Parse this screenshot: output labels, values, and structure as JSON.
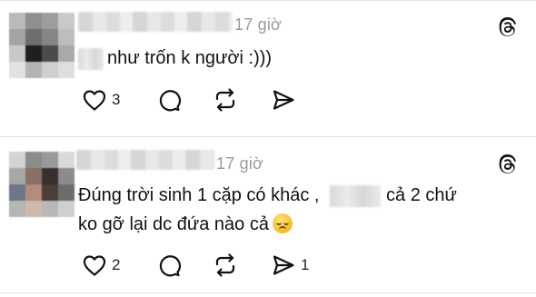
{
  "posts": [
    {
      "time": "17 giờ",
      "text": "như trốn k người :)))",
      "actions": {
        "like_count": "3",
        "repost_count": "",
        "share_count": ""
      }
    },
    {
      "time": "17 giờ",
      "text_line1_before": "Đúng trời sinh 1 cặp có khác ,",
      "text_line1_after": "cả 2 chứ",
      "text_line2": "ko gỡ lại dc đứa nào cả",
      "actions": {
        "like_count": "2",
        "share_count": "1"
      }
    }
  ],
  "icons": {
    "app": "threads-logo-icon",
    "like": "heart-icon",
    "comment": "comment-bubble-icon",
    "repost": "repost-icon",
    "share": "send-icon"
  },
  "colors": {
    "text": "#111111",
    "muted": "#9b9b9b",
    "separator": "#e4e4e4",
    "emoji": "#f7c231"
  }
}
